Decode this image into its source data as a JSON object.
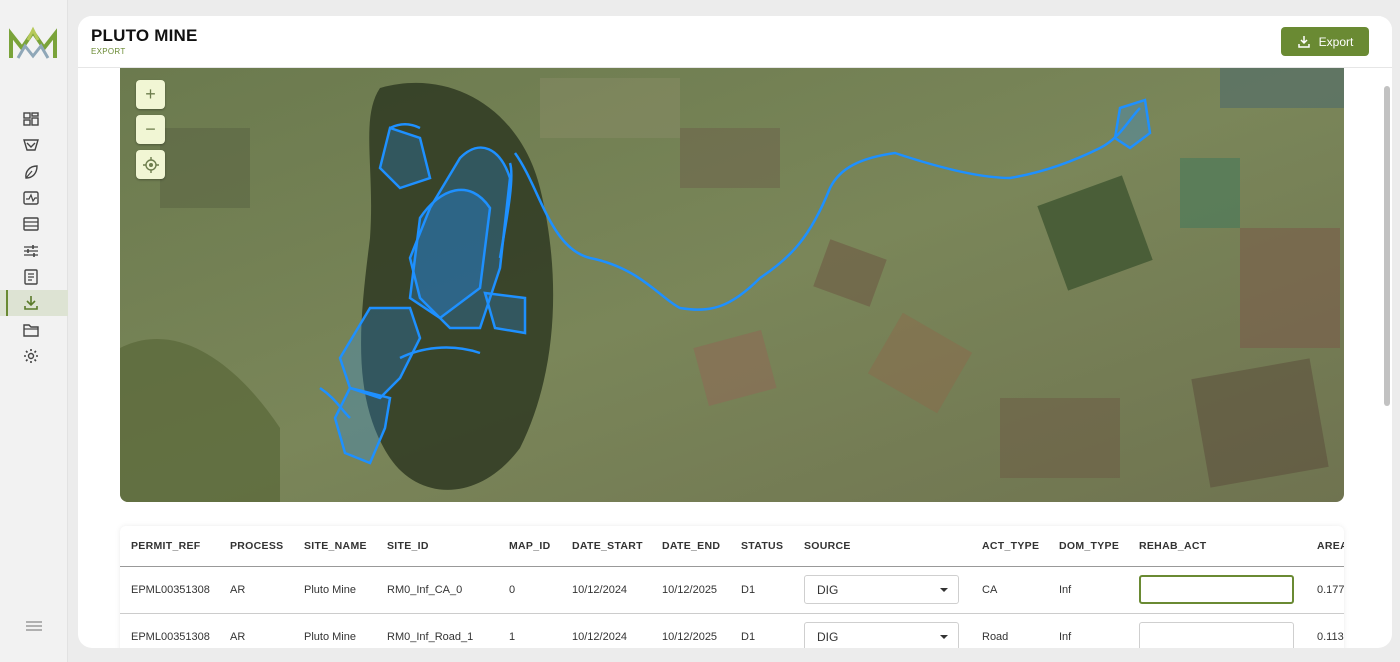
{
  "app": {
    "title": "PLUTO MINE",
    "subtitle": "EXPORT"
  },
  "header": {
    "export_label": "Export"
  },
  "sidebar": {
    "items": [
      {
        "icon": "dashboard-icon"
      },
      {
        "icon": "mine-icon"
      },
      {
        "icon": "leaf-icon"
      },
      {
        "icon": "monitoring-icon"
      },
      {
        "icon": "table-icon"
      },
      {
        "icon": "sliders-icon"
      },
      {
        "icon": "report-icon"
      },
      {
        "icon": "download-icon",
        "active": true
      },
      {
        "icon": "folder-icon"
      },
      {
        "icon": "gear-icon"
      }
    ],
    "menu_icon": "hamburger-icon"
  },
  "map": {
    "controls": {
      "zoom_in": "+",
      "zoom_out": "−",
      "locate": "locate-icon"
    },
    "overlay_color": "#1e90ff"
  },
  "table": {
    "columns": [
      "PERMIT_REF",
      "PROCESS",
      "SITE_NAME",
      "SITE_ID",
      "MAP_ID",
      "DATE_START",
      "DATE_END",
      "STATUS",
      "SOURCE",
      "ACT_TYPE",
      "DOM_TYPE",
      "REHAB_ACT",
      "AREA"
    ],
    "rows": [
      {
        "permit_ref": "EPML00351308",
        "process": "AR",
        "site_name": "Pluto Mine",
        "site_id": "RM0_Inf_CA_0",
        "map_id": "0",
        "date_start": "10/12/2024",
        "date_end": "10/12/2025",
        "status": "D1",
        "source": "DIG",
        "act_type": "CA",
        "dom_type": "Inf",
        "rehab_act": "",
        "area": "0.177"
      },
      {
        "permit_ref": "EPML00351308",
        "process": "AR",
        "site_name": "Pluto Mine",
        "site_id": "RM0_Inf_Road_1",
        "map_id": "1",
        "date_start": "10/12/2024",
        "date_end": "10/12/2025",
        "status": "D1",
        "source": "DIG",
        "act_type": "Road",
        "dom_type": "Inf",
        "rehab_act": "",
        "area": "0.113"
      }
    ]
  },
  "colors": {
    "accent": "#6a8a33",
    "active_bg": "#dde3d3"
  }
}
